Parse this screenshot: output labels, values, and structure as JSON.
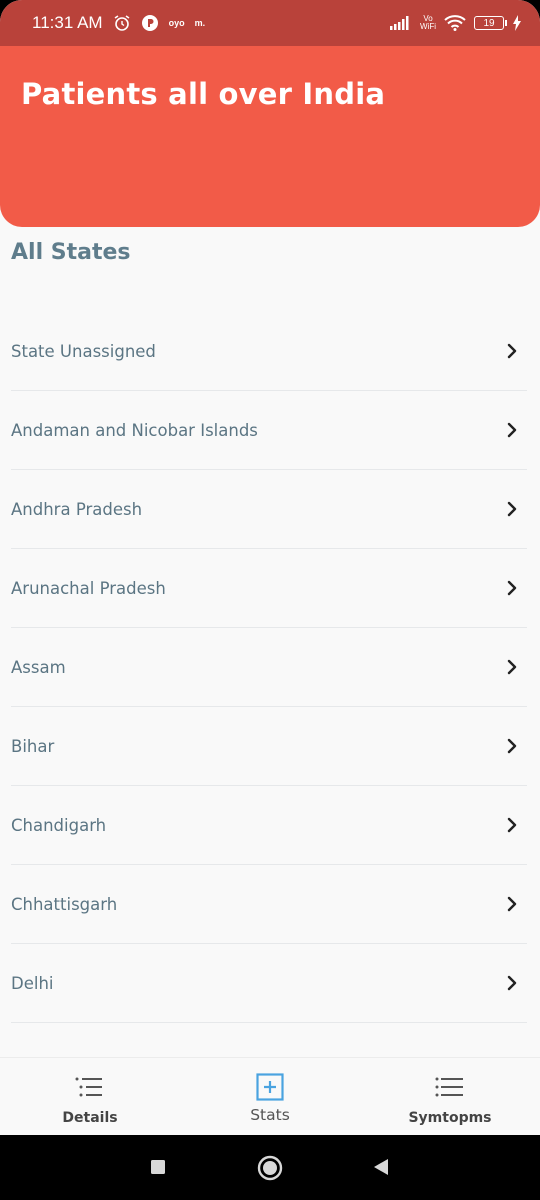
{
  "status_bar": {
    "time": "11:31 AM",
    "carrier_tag_1": "oyo",
    "carrier_tag_2": "m.",
    "wifi_tag_top": "Vo",
    "wifi_tag_bottom": "WiFi",
    "battery": "19"
  },
  "header": {
    "title": "Patients all over India"
  },
  "section": {
    "title": "All States"
  },
  "states": [
    "State Unassigned",
    "Andaman and Nicobar Islands",
    "Andhra Pradesh",
    "Arunachal Pradesh",
    "Assam",
    "Bihar",
    "Chandigarh",
    "Chhattisgarh",
    "Delhi"
  ],
  "bottom_nav": {
    "details": "Details",
    "stats": "Stats",
    "symptoms": "Symtopms"
  },
  "colors": {
    "header": "#f25b48",
    "status_bar": "#b9423a",
    "text_muted": "#5b7583",
    "accent_icon": "#4aa3e0"
  }
}
